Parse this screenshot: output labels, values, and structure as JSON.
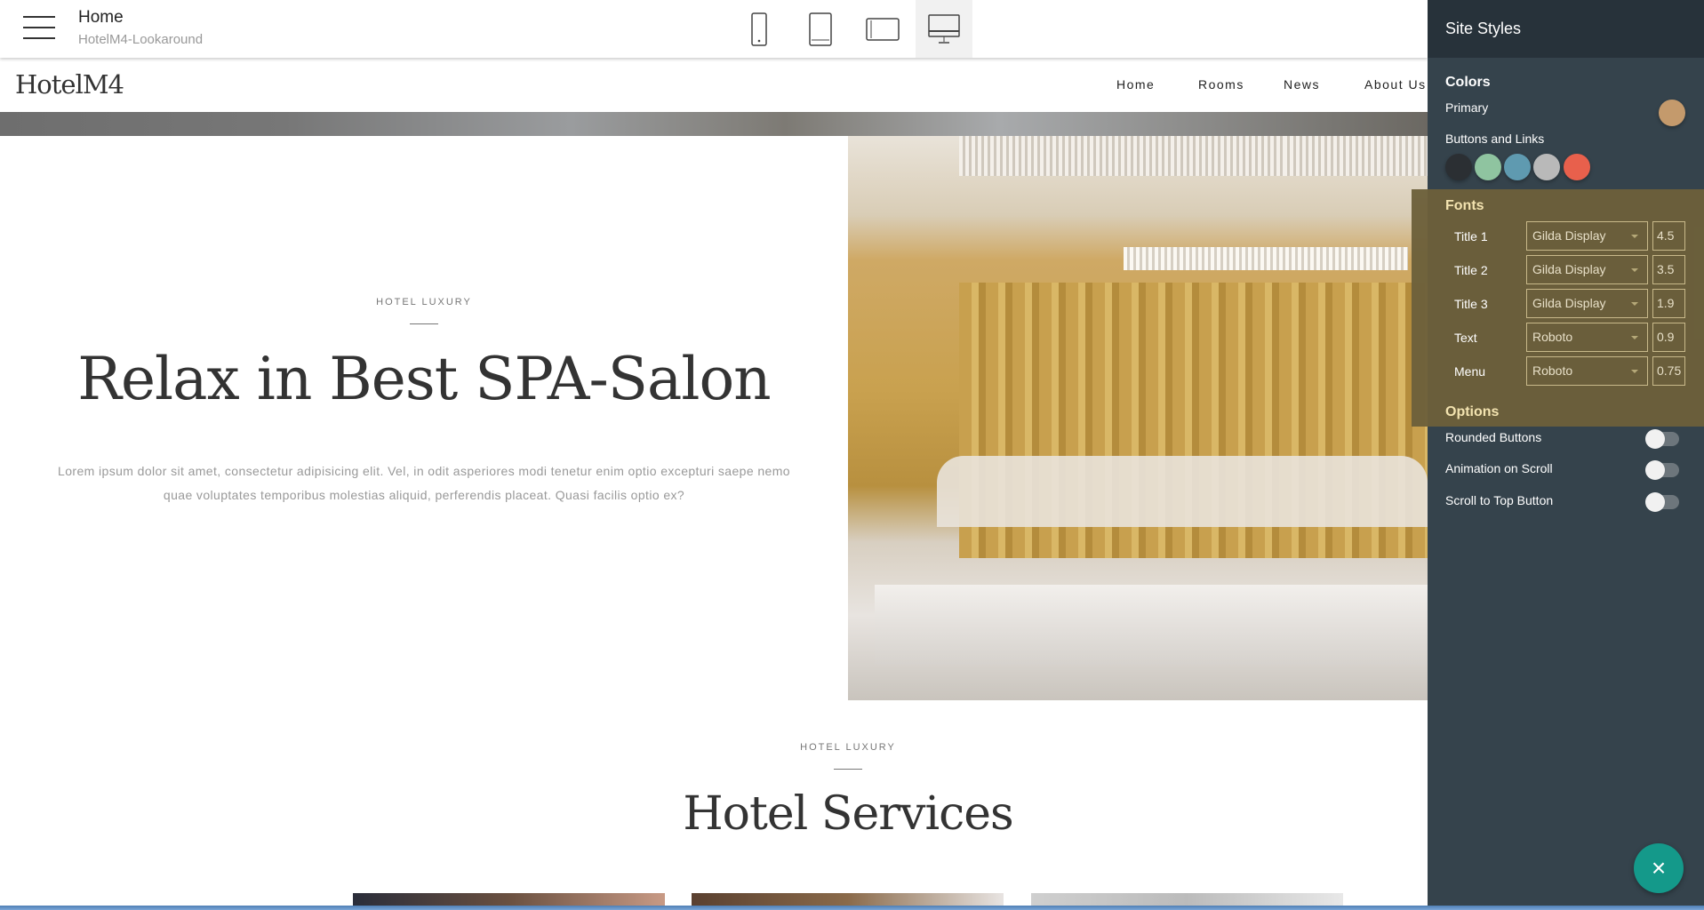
{
  "topbar": {
    "title": "Home",
    "subtitle": "HotelM4-Lookaround",
    "devices": [
      "mobile-icon",
      "tablet-icon",
      "tablet-landscape-icon",
      "desktop-icon"
    ],
    "active_device": "desktop"
  },
  "site": {
    "logo": "HotelM4",
    "nav": [
      "Home",
      "Rooms",
      "News",
      "About Us"
    ]
  },
  "hero": {
    "eyebrow": "HOTEL LUXURY",
    "title": "Relax in Best SPA-Salon",
    "text": "Lorem ipsum dolor sit amet, consectetur adipisicing elit. Vel, in odit asperiores modi tenetur enim optio excepturi saepe nemo quae voluptates temporibus molestias aliquid, perferendis placeat. Quasi facilis optio ex?"
  },
  "services": {
    "eyebrow": "HOTEL LUXURY",
    "title": "Hotel Services"
  },
  "panel": {
    "title": "Site Styles",
    "colors_label": "Colors",
    "primary_label": "Primary",
    "primary_color": "#c49a6c",
    "buttons_label": "Buttons and Links",
    "button_colors": [
      "#2b2f33",
      "#8fc4a0",
      "#5f9ab0",
      "#b9b9b9",
      "#e8604c"
    ],
    "fonts_label": "Fonts",
    "fonts": [
      {
        "label": "Title 1",
        "font": "Gilda Display",
        "size": "4.5"
      },
      {
        "label": "Title 2",
        "font": "Gilda Display",
        "size": "3.5"
      },
      {
        "label": "Title 3",
        "font": "Gilda Display",
        "size": "1.9"
      },
      {
        "label": "Text",
        "font": "Roboto",
        "size": "0.9"
      },
      {
        "label": "Menu",
        "font": "Roboto",
        "size": "0.75"
      }
    ],
    "options_label": "Options",
    "options": [
      {
        "label": "Rounded Buttons",
        "on": false
      },
      {
        "label": "Animation on Scroll",
        "on": false
      },
      {
        "label": "Scroll to Top Button",
        "on": false
      }
    ]
  },
  "fab": {
    "icon": "close-icon",
    "glyph": "×",
    "color": "#14998a"
  }
}
